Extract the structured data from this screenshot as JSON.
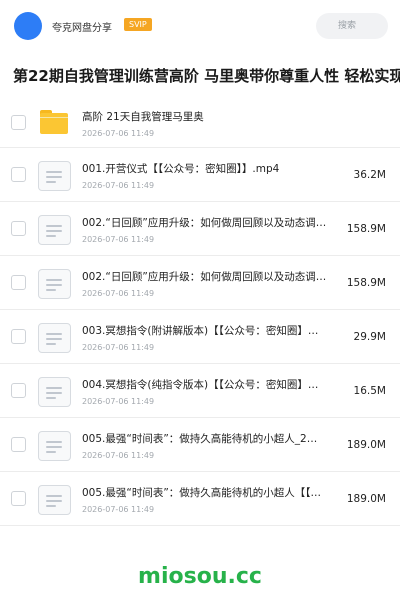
{
  "header": {
    "brand": "夸克网盘分享",
    "badge": "SVIP",
    "search_placeholder": "搜索"
  },
  "page_title": "第22期自我管理训练营高阶 马里奥带你尊重人性 轻松实现",
  "files": [
    {
      "type": "folder",
      "name": "高阶 21天自我管理马里奥",
      "date": "2026-07-06 11:49",
      "size": ""
    },
    {
      "type": "file",
      "name": "001.开营仪式【【公众号：密知圈】】.mp4",
      "date": "2026-07-06 11:49",
      "size": "36.2M"
    },
    {
      "type": "file",
      "name": "002.“日回顾”应用升级：如何做周回顾以及动态调…",
      "date": "2026-07-06 11:49",
      "size": "158.9M"
    },
    {
      "type": "file",
      "name": "002.“日回顾”应用升级：如何做周回顾以及动态调…",
      "date": "2026-07-06 11:49",
      "size": "158.9M"
    },
    {
      "type": "file",
      "name": "003.冥想指令(附讲解版本)【【公众号：密知圈】…",
      "date": "2026-07-06 11:49",
      "size": "29.9M"
    },
    {
      "type": "file",
      "name": "004.冥想指令(纯指令版本)【【公众号：密知圈】…",
      "date": "2026-07-06 11:49",
      "size": "16.5M"
    },
    {
      "type": "file",
      "name": "005.最强“时间表”：做持久高能待机的小超人_2…",
      "date": "2026-07-06 11:49",
      "size": "189.0M"
    },
    {
      "type": "file",
      "name": "005.最强“时间表”：做持久高能待机的小超人【【…",
      "date": "2026-07-06 11:49",
      "size": "189.0M"
    }
  ],
  "watermark": "miosou.cc"
}
